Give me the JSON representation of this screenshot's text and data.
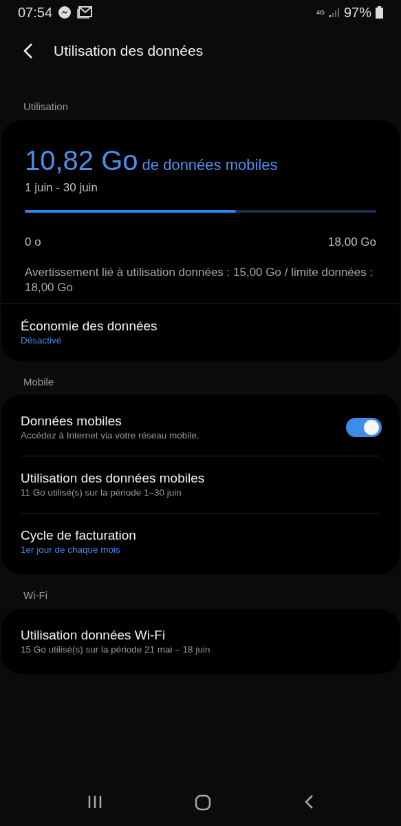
{
  "status_bar": {
    "time": "07:54",
    "network": "4G",
    "battery": "97%"
  },
  "header": {
    "title": "Utilisation des données"
  },
  "usage": {
    "section": "Utilisation",
    "amount": "10,82 Go",
    "amount_suffix": "de données mobiles",
    "period": "1 juin - 30 juin",
    "level": 0.6,
    "min_label": "0 o",
    "max_label": "18,00 Go",
    "warning": "Avertissement lié à utilisation données : 15,00 Go / limite données : 18,00 Go",
    "items": [
      {
        "kind": "link",
        "title": "Économie des données",
        "subtitle": "Désactivé",
        "accent": true
      }
    ]
  },
  "sections": [
    {
      "title": "Mobile",
      "items": [
        {
          "kind": "switch",
          "title": "Données mobiles",
          "subtitle": "Accédez à Internet via votre réseau mobile.",
          "on": true
        },
        {
          "kind": "link",
          "title": "Utilisation des données mobiles",
          "subtitle": "11 Go utilisé(s) sur la période 1–30 juin",
          "accent": false
        },
        {
          "kind": "link",
          "title": "Cycle de facturation",
          "subtitle": "1er jour de chaque mois",
          "accent": true
        }
      ]
    },
    {
      "title": "Wi-Fi",
      "items": [
        {
          "kind": "link",
          "title": "Utilisation données Wi-Fi",
          "subtitle": "15 Go utilisé(s) sur la période 21 mai – 18 juin",
          "accent": false
        }
      ]
    }
  ]
}
